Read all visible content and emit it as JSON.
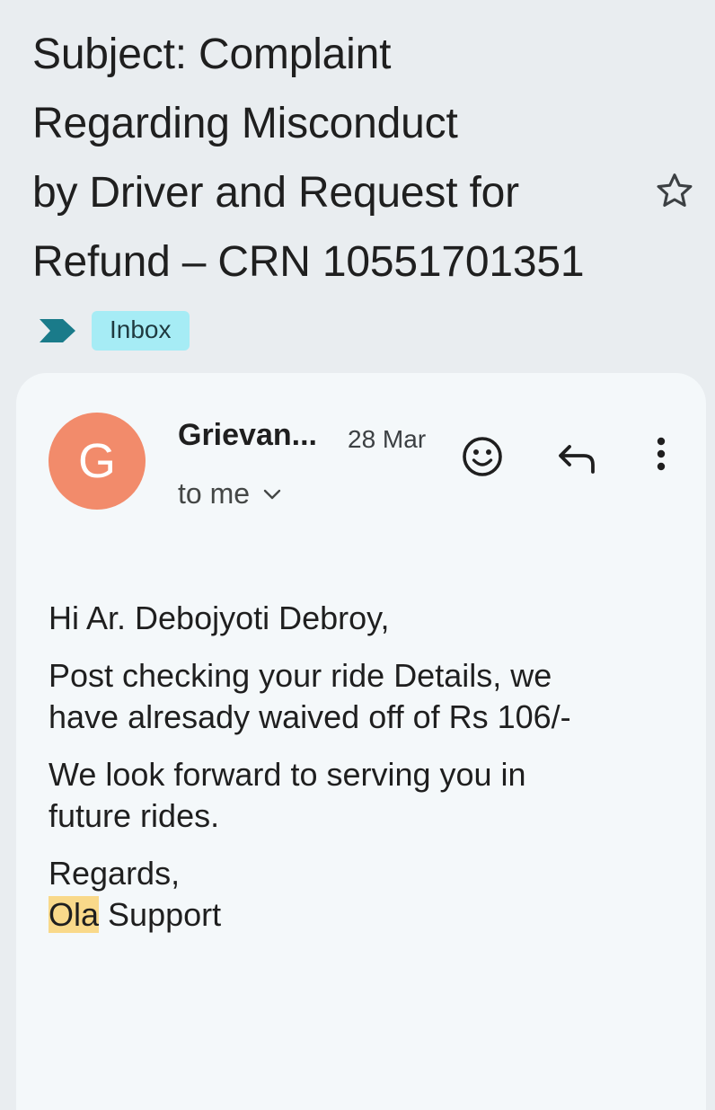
{
  "subject": {
    "lines": [
      "Subject: Complaint",
      "Regarding Misconduct",
      "by Driver and Request for",
      "Refund – CRN 10551701351"
    ]
  },
  "labels": {
    "inbox": "Inbox"
  },
  "message": {
    "avatar_letter": "G",
    "avatar_color": "#f28b6b",
    "sender": "Grievan...",
    "date": "28 Mar",
    "recipient": "to me",
    "body": {
      "greeting": "Hi Ar. Debojyoti Debroy,",
      "paragraph1_line1": "Post checking your ride Details, we",
      "paragraph1_line2": "have alresady waived off of Rs 106/-",
      "paragraph2_line1": "We look forward to serving you in",
      "paragraph2_line2": "future rides.",
      "signoff": "Regards,",
      "signature_highlight": "Ola",
      "signature_rest": " Support"
    }
  },
  "colors": {
    "background": "#e9edf0",
    "card": "#f4f8fa",
    "inbox_chip": "#a6ecf5",
    "importance_marker": "#1a7b8a",
    "highlight": "#f9d98a"
  },
  "icons": {
    "star": "star-outline-icon",
    "importance": "importance-marker-icon",
    "emoji": "add-reaction-icon",
    "reply": "reply-icon",
    "more": "more-vert-icon",
    "expand": "chevron-down-icon"
  }
}
